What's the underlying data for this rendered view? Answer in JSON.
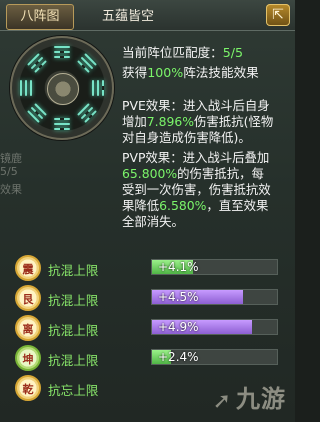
{
  "header": {
    "active_tab": "八阵图",
    "tab2": "五蕴皆空",
    "corner_icon": "share-icon"
  },
  "wheel": {
    "accent": "#79e3c7",
    "trigrams": [
      {
        "name": "top",
        "lines": [
          "solid",
          "broken",
          "broken"
        ]
      },
      {
        "name": "top-right",
        "lines": [
          "solid",
          "solid",
          "broken"
        ]
      },
      {
        "name": "right",
        "lines": [
          "broken",
          "solid",
          "solid"
        ]
      },
      {
        "name": "bottom-right",
        "lines": [
          "broken",
          "broken",
          "solid"
        ]
      },
      {
        "name": "bottom",
        "lines": [
          "broken",
          "solid",
          "broken"
        ]
      },
      {
        "name": "bottom-left",
        "lines": [
          "solid",
          "broken",
          "solid"
        ]
      },
      {
        "name": "left",
        "lines": [
          "solid",
          "solid",
          "solid"
        ]
      },
      {
        "name": "top-left",
        "lines": [
          "solid",
          "broken",
          "broken"
        ]
      }
    ]
  },
  "left_faded": {
    "line1": "镜鹿",
    "line2": "5/5",
    "line3": "效果"
  },
  "info": {
    "match_label": "当前阵位匹配度：",
    "match_value": "5/5",
    "gain_prefix": "获得",
    "gain_value": "100%",
    "gain_suffix": "阵法技能效果"
  },
  "pve": {
    "l1": "PVE效果：进入战斗后自身",
    "l2_a": "增加",
    "l2_val": "7.896%",
    "l2_b": "伤害抵抗(怪物",
    "l3": "对自身造成伤害降低)。"
  },
  "pvp": {
    "l1": "PVP效果：进入战斗后叠加",
    "l2_val": "65.800%",
    "l2_b": "的伤害抵抗，每",
    "l3": "受到一次伤害，伤害抵抗效",
    "l4_a": "果降低",
    "l4_val": "6.580%",
    "l4_b": "，直至效果",
    "l5": "全部消失。"
  },
  "rows": [
    {
      "badge": "震",
      "badge_style": "gold",
      "label": "抗混上限",
      "value": "+4.1%",
      "fill": 0.33,
      "bar_color": "green"
    },
    {
      "badge": "艮",
      "badge_style": "gold",
      "label": "抗混上限",
      "value": "+4.5%",
      "fill": 0.73,
      "bar_color": "purple"
    },
    {
      "badge": "离",
      "badge_style": "gold",
      "label": "抗混上限",
      "value": "+4.9%",
      "fill": 0.8,
      "bar_color": "purple"
    },
    {
      "badge": "坤",
      "badge_style": "green",
      "label": "抗混上限",
      "value": "+2.4%",
      "fill": 0.15,
      "bar_color": "green"
    },
    {
      "badge": "乾",
      "badge_style": "gold",
      "label": "抗忘上限",
      "value": "",
      "fill": 0.0,
      "bar_color": "green"
    }
  ],
  "watermark": {
    "text": "九游",
    "icon": "jiuyou-logo-icon"
  },
  "colors": {
    "highlight_green": "#7bf56a",
    "row_label_green": "#88e56a",
    "purple_bar": "#a77ff0",
    "green_bar": "#79d662"
  }
}
